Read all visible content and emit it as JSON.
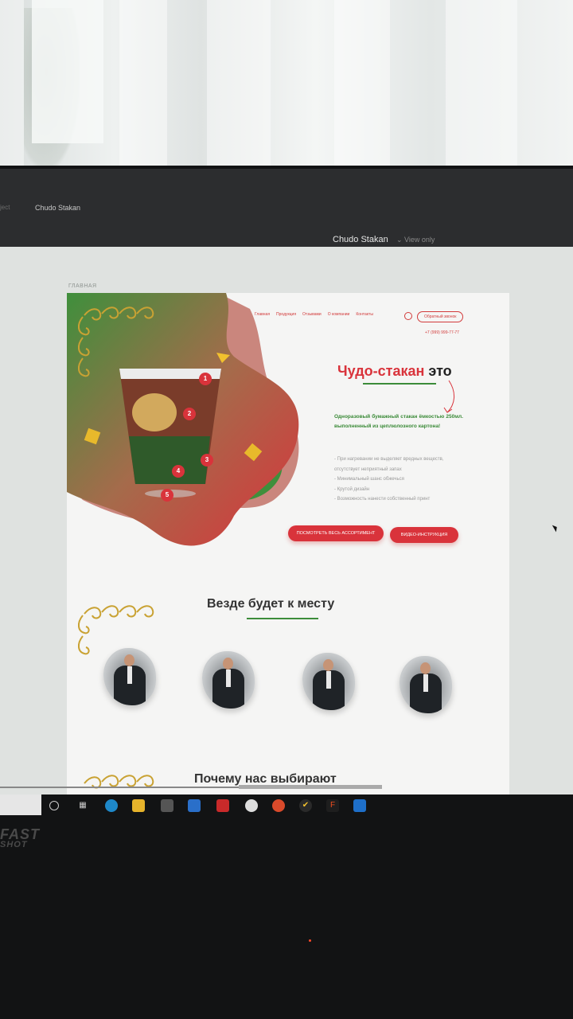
{
  "browser": {
    "faded_tab": "ject",
    "tab_title": "Chudo Stakan",
    "file_name": "Chudo Stakan",
    "view_mode": "View only"
  },
  "frame": {
    "label": "ГЛАВНАЯ"
  },
  "nav": {
    "items": [
      "Главная",
      "Продукция",
      "Отзывами",
      "О компании",
      "Контакты"
    ],
    "call_button": "Обратный звонок",
    "phone": "+7 (999) 999-77-77"
  },
  "hero": {
    "title_red": "Чудо-стакан",
    "title_dark": "это",
    "subtitle": "Одноразовый бумажный стакан ёмкостью 250мл. выполненный из цеплюлозного картона!",
    "bullets": [
      "- При нагревании не выделяет вредных веществ, отсутствует неприятный запах",
      "- Минимальный шанс обжечься",
      "- Крутой дизайн",
      "- Возможность нанести собственный принт"
    ],
    "button_catalog": "ПОСМОТРЕТЬ ВЕСЬ АССОРТИМЕНТ",
    "button_video": "ВИДЕО-ИНСТРУКЦИЯ",
    "badges": [
      "1",
      "2",
      "3",
      "4",
      "5"
    ]
  },
  "section_everywhere": {
    "title": "Везде будет к месту"
  },
  "section_why": {
    "title": "Почему нас выбирают"
  },
  "overlay": {
    "logo_text": "FAST",
    "logo_sub": "SHOT"
  },
  "colors": {
    "accent_red": "#d9333b",
    "accent_green": "#3c8c3a",
    "ornament_gold": "#c9a233"
  },
  "taskbar": {
    "icons": [
      "search-circle-icon",
      "task-view-icon",
      "edge-icon",
      "file-explorer-icon",
      "store-icon",
      "mail-icon",
      "app-red-icon",
      "xbox-icon",
      "chrome-icon",
      "norton-icon",
      "figma-icon",
      "vscode-icon"
    ]
  }
}
